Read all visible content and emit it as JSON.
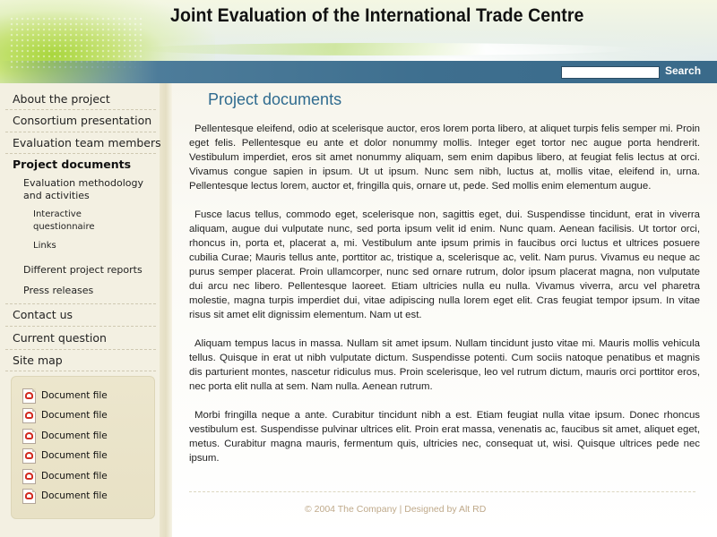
{
  "header": {
    "site_title": "Joint Evaluation of the International Trade Centre",
    "search_label": "Search",
    "search_value": ""
  },
  "sidebar": {
    "nav": [
      {
        "label": "About the project"
      },
      {
        "label": "Consortium presentation"
      },
      {
        "label": "Evaluation team members"
      },
      {
        "label": "Project documents",
        "active": true
      },
      {
        "label": "Contact us"
      },
      {
        "label": "Current question"
      },
      {
        "label": "Site map"
      }
    ],
    "subnav": [
      {
        "label": "Evaluation methodology and activities"
      },
      {
        "label": "Different project reports"
      },
      {
        "label": "Press releases"
      }
    ],
    "subsubnav": [
      {
        "label": "Interactive questionnaire"
      },
      {
        "label": "Links"
      }
    ],
    "documents": [
      {
        "label": "Document file",
        "icon": "pdf-icon"
      },
      {
        "label": "Document file",
        "icon": "pdf-icon"
      },
      {
        "label": "Document file",
        "icon": "pdf-icon"
      },
      {
        "label": "Document file",
        "icon": "pdf-icon"
      },
      {
        "label": "Document file",
        "icon": "pdf-icon"
      },
      {
        "label": "Document file",
        "icon": "pdf-icon"
      }
    ]
  },
  "main": {
    "title": "Project documents",
    "paragraphs": [
      "Pellentesque eleifend, odio at scelerisque auctor, eros lorem porta libero, at aliquet turpis felis semper mi. Proin eget felis. Pellentesque eu ante et dolor nonummy mollis. Integer eget tortor nec augue porta hendrerit. Vestibulum imperdiet, eros sit amet nonummy aliquam, sem enim dapibus libero, at feugiat felis lectus at orci. Vivamus congue sapien in ipsum. Ut ut ipsum. Nunc sem nibh, luctus at, mollis vitae, eleifend in, urna. Pellentesque lectus lorem, auctor et, fringilla quis, ornare ut, pede. Sed mollis enim elementum augue.",
      "Fusce lacus tellus, commodo eget, scelerisque non, sagittis eget, dui. Suspendisse tincidunt, erat in viverra aliquam, augue dui vulputate nunc, sed porta ipsum velit id enim. Nunc quam. Aenean facilisis. Ut tortor orci, rhoncus in, porta et, placerat a, mi. Vestibulum ante ipsum primis in faucibus orci luctus et ultrices posuere cubilia Curae; Mauris tellus ante, porttitor ac, tristique a, scelerisque ac, velit. Nam purus. Vivamus eu neque ac purus semper placerat. Proin ullamcorper, nunc sed ornare rutrum, dolor ipsum placerat magna, non vulputate dui arcu nec libero. Pellentesque laoreet. Etiam ultricies nulla eu nulla. Vivamus viverra, arcu vel pharetra molestie, magna turpis imperdiet dui, vitae adipiscing nulla lorem eget elit. Cras feugiat tempor ipsum. In vitae risus sit amet elit dignissim elementum. Nam ut est.",
      "Aliquam tempus lacus in massa. Nullam sit amet ipsum. Nullam tincidunt justo vitae mi. Mauris mollis vehicula tellus. Quisque in erat ut nibh vulputate dictum. Suspendisse potenti. Cum sociis natoque penatibus et magnis dis parturient montes, nascetur ridiculus mus. Proin scelerisque, leo vel rutrum dictum, mauris orci porttitor eros, nec porta elit nulla at sem. Nam nulla. Aenean rutrum.",
      "Morbi fringilla neque a ante. Curabitur tincidunt nibh a est. Etiam feugiat nulla vitae ipsum. Donec rhoncus vestibulum est. Suspendisse pulvinar ultrices elit. Proin erat massa, venenatis ac, faucibus sit amet, aliquet eget, metus. Curabitur magna mauris, fermentum quis, ultricies nec, consequat ut, wisi. Quisque ultrices pede nec ipsum."
    ]
  },
  "footer": {
    "text": "© 2004 The Company | Designed by Alt RD"
  },
  "colors": {
    "title_blue": "#2f6b8f",
    "header_bar": "#3e6f8f",
    "sidebar_bg": "#f3f0e2",
    "footer_text": "#bfa98a"
  }
}
